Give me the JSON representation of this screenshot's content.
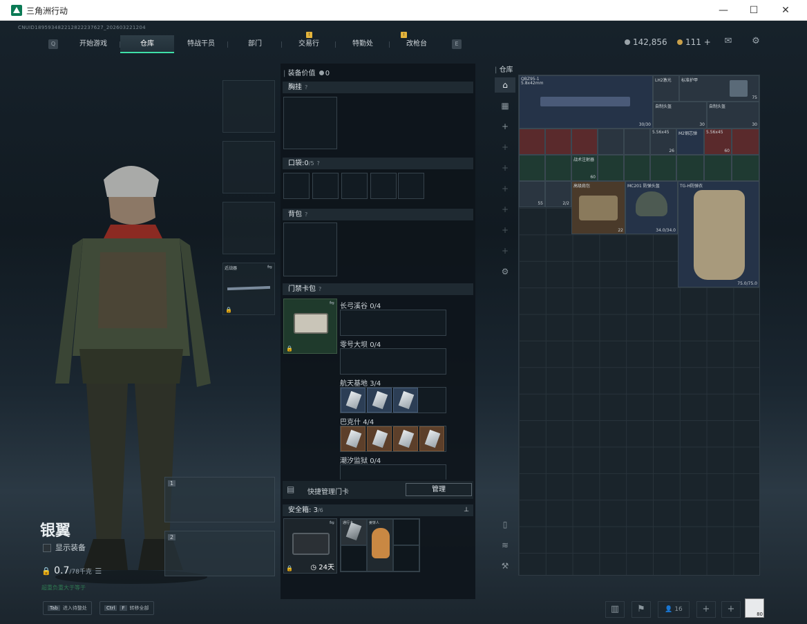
{
  "window": {
    "title": "三角洲行动",
    "btn_min": "—",
    "btn_max": "☐",
    "btn_close": "✕"
  },
  "uid": "CNUID189593482212822237627_202603221204",
  "nav": {
    "key_left": "Q",
    "key_right": "E",
    "tabs": [
      {
        "label": "开始游戏"
      },
      {
        "label": "仓库",
        "active": true
      },
      {
        "label": "特战干员"
      },
      {
        "label": "部门"
      },
      {
        "label": "交易行",
        "badge": "!"
      },
      {
        "label": "特勤处"
      },
      {
        "label": "改枪台",
        "badge": "!"
      }
    ]
  },
  "currency": {
    "coin": "142,856",
    "coin_color": "#9aa3a9",
    "gold": "111",
    "gold_color": "#c9a04a",
    "plus": "+"
  },
  "operator": {
    "name": "银翼",
    "show_gear": "显示装备",
    "weight": "0.7",
    "weight_max": "/78千克",
    "note": "超重负重大于等于"
  },
  "melee": {
    "label": "近战器"
  },
  "weapon_slots": [
    {
      "num": "1"
    },
    {
      "num": "2"
    }
  ],
  "gear": {
    "value_label": "装备价值",
    "value": "0",
    "chest_label": "胸挂",
    "pocket_label": "口袋:",
    "pocket_val": "0",
    "pocket_max": "/5",
    "backpack_label": "背包",
    "keycard_label": "门禁卡包",
    "keycards": [
      {
        "name": "长弓溪谷",
        "count": "0/4"
      },
      {
        "name": "零号大坝",
        "count": "0/4"
      },
      {
        "name": "航天基地",
        "count": "3/4"
      },
      {
        "name": "巴克什",
        "count": "4/4"
      },
      {
        "name": "潮汐监狱",
        "count": "0/4"
      }
    ],
    "quick_label": "快捷管理门卡",
    "manage": "管理",
    "safe_label": "安全箱:",
    "safe_val": "3",
    "safe_max": "/6",
    "safe_time": "24天",
    "safe_item1": "通行卡",
    "safe_item2": "姜饼人"
  },
  "warehouse": {
    "label": "仓库",
    "items": [
      {
        "name": "QBZ95-1",
        "sub": "5.8x42mm",
        "val": "30/30"
      },
      {
        "name": "LH2激光",
        "val": ""
      },
      {
        "name": "标准护甲",
        "val": "75"
      },
      {
        "name": "自制头盔",
        "val": "30"
      },
      {
        "name": "自制头盔",
        "val": "30"
      },
      {
        "name": "5.56x45",
        "val": "26"
      },
      {
        "name": "M2钢芯弹",
        "val": "60"
      },
      {
        "name": "5.56x45",
        "val": "60"
      },
      {
        "name": "战术注射器",
        "val": "60"
      },
      {
        "name": "MC201 防弹头盔",
        "val": "34.0/34.0"
      },
      {
        "name": "TG-H防弹衣",
        "val": "75.0/75.0"
      },
      {
        "name": "高级肩包",
        "val": "22"
      },
      {
        "name": "2/2",
        "val": "2/2"
      },
      {
        "name": "55",
        "val": "55"
      }
    ]
  },
  "bottom": {
    "tab_key": "Tab",
    "tab_label": "进入待整处",
    "ctrl_key": "Ctrl",
    "f_key": "F",
    "ctrl_label": "转移全部",
    "players": "16",
    "avatar_badge": "80"
  }
}
